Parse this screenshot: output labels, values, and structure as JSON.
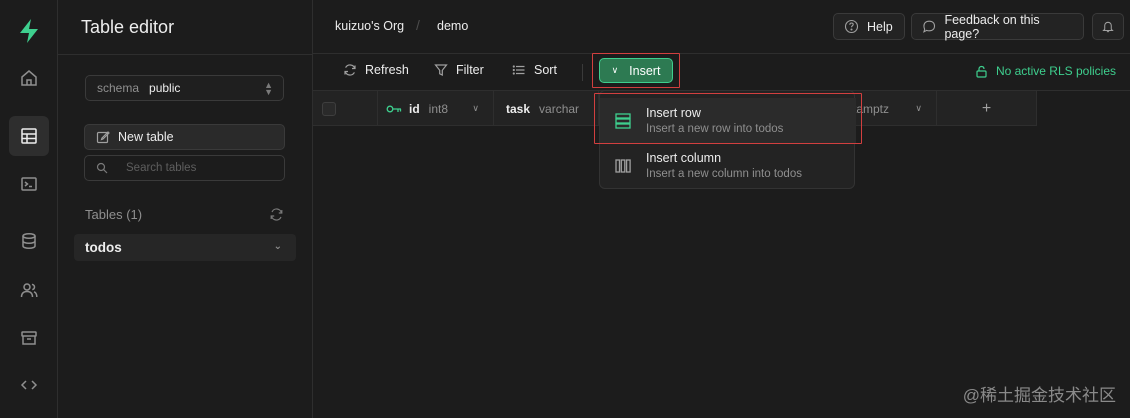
{
  "sidebar": {
    "title": "Table editor",
    "schema_label": "schema",
    "schema_value": "public",
    "new_table_label": "New table",
    "search_placeholder": "Search tables",
    "tables_heading": "Tables (1)",
    "tables": [
      {
        "label": "todos"
      }
    ]
  },
  "header": {
    "org": "kuizuo's Org",
    "separator": "/",
    "project": "demo",
    "help_label": "Help",
    "feedback_label": "Feedback on this page?"
  },
  "toolbar": {
    "refresh_label": "Refresh",
    "filter_label": "Filter",
    "sort_label": "Sort",
    "insert_label": "Insert",
    "rls_label": "No active RLS policies"
  },
  "grid": {
    "columns": [
      {
        "name": "id",
        "type": "int8"
      },
      {
        "name": "task",
        "type": "varchar"
      },
      {
        "name": "",
        "type": "tamptz"
      }
    ],
    "add_column_glyph": "+"
  },
  "insert_menu": {
    "items": [
      {
        "title": "Insert row",
        "description": "Insert a new row into todos"
      },
      {
        "title": "Insert column",
        "description": "Insert a new column into todos"
      }
    ]
  },
  "watermark": "@稀土掘金技术社区",
  "colors": {
    "accent": "#3ecf8e",
    "background": "#1c1c1c",
    "highlight": "#d23f3f"
  },
  "icons": [
    "supabase-logo",
    "home-icon",
    "table-icon",
    "terminal-icon",
    "database-icon",
    "users-icon",
    "archive-icon",
    "code-icon",
    "help-icon",
    "feedback-icon",
    "bell-icon",
    "refresh-icon",
    "filter-icon",
    "sort-icon",
    "lock-icon",
    "key-icon",
    "rows-icon",
    "columns-icon",
    "edit-icon",
    "search-icon"
  ]
}
